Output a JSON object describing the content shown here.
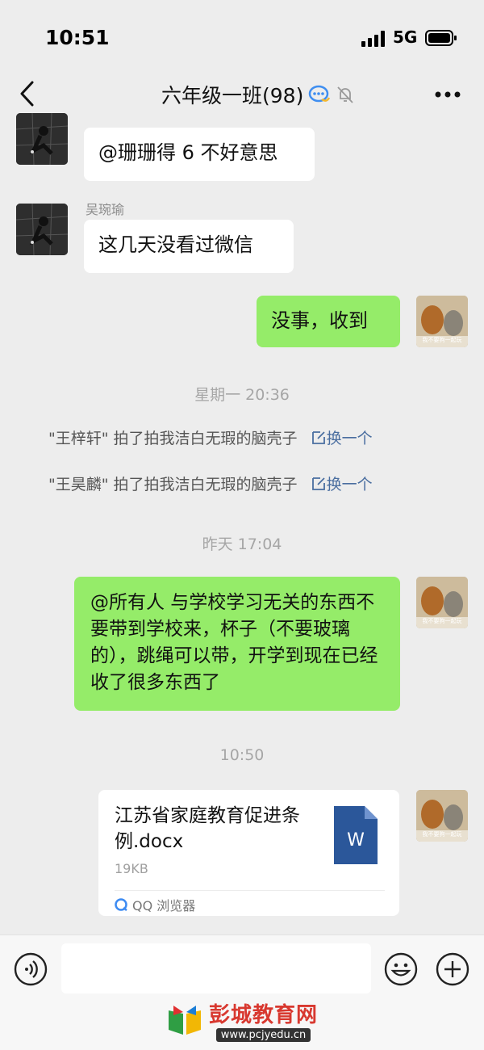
{
  "status_bar": {
    "time": "10:51",
    "network": "5G"
  },
  "header": {
    "title": "六年级一班(98)"
  },
  "messages": {
    "m1": {
      "text": "@珊珊得 6 不好意思"
    },
    "m2": {
      "sender": "吴琬瑜",
      "text": "这几天没看过微信"
    },
    "m3": {
      "text": "没事，收到"
    },
    "m4": {
      "text": "@所有人 与学校学习无关的东西不要带到学校来，杯子（不要玻璃的），跳绳可以带，开学到现在已经收了很多东西了"
    }
  },
  "timestamps": {
    "t1": "星期一 20:36",
    "t2": "昨天 17:04",
    "t3": "10:50"
  },
  "system": {
    "pat1": "\"王梓轩\" 拍了拍我洁白无瑕的脑壳子",
    "pat2": "\"王昊麟\" 拍了拍我洁白无瑕的脑壳子",
    "change_label": "换一个"
  },
  "file": {
    "name": "江苏省家庭教育促进条例.docx",
    "size": "19KB",
    "source": "QQ 浏览器",
    "badge": "W"
  },
  "avatar_caption": "我不要狗一起玩",
  "watermark": {
    "name": "彭城教育网",
    "url": "www.pcjyedu.cn"
  },
  "colors": {
    "green_bubble": "#95ec69",
    "background": "#ededed",
    "link": "#4a6ea0",
    "word_blue": "#2b579a"
  }
}
